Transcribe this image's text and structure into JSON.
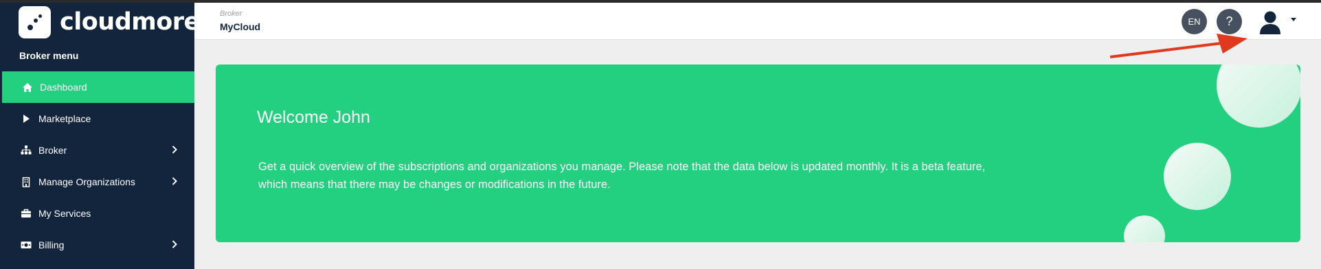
{
  "brand": {
    "name": "cloudmore"
  },
  "sidebar": {
    "menu_title": "Broker menu",
    "items": [
      {
        "label": "Dashboard",
        "icon": "home-icon",
        "active": true,
        "has_submenu": false
      },
      {
        "label": "Marketplace",
        "icon": "play-icon",
        "active": false,
        "has_submenu": false
      },
      {
        "label": "Broker",
        "icon": "sitemap-icon",
        "active": false,
        "has_submenu": true
      },
      {
        "label": "Manage Organizations",
        "icon": "building-icon",
        "active": false,
        "has_submenu": true
      },
      {
        "label": "My Services",
        "icon": "briefcase-icon",
        "active": false,
        "has_submenu": false
      },
      {
        "label": "Billing",
        "icon": "money-icon",
        "active": false,
        "has_submenu": true
      }
    ]
  },
  "header": {
    "breadcrumb_parent": "Broker",
    "breadcrumb_current": "MyCloud",
    "language": "EN",
    "help_label": "?",
    "user_menu_icon": "user-avatar-icon"
  },
  "welcome": {
    "title": "Welcome John",
    "text": "Get a quick overview of the subscriptions and organizations you manage. Please note that the data below is updated monthly. It is a beta feature, which means that there may be changes or modifications in the future."
  },
  "colors": {
    "sidebar_bg": "#13253d",
    "accent_green": "#22d07f",
    "annotation_red": "#e03a1e",
    "header_button": "#46505f"
  }
}
